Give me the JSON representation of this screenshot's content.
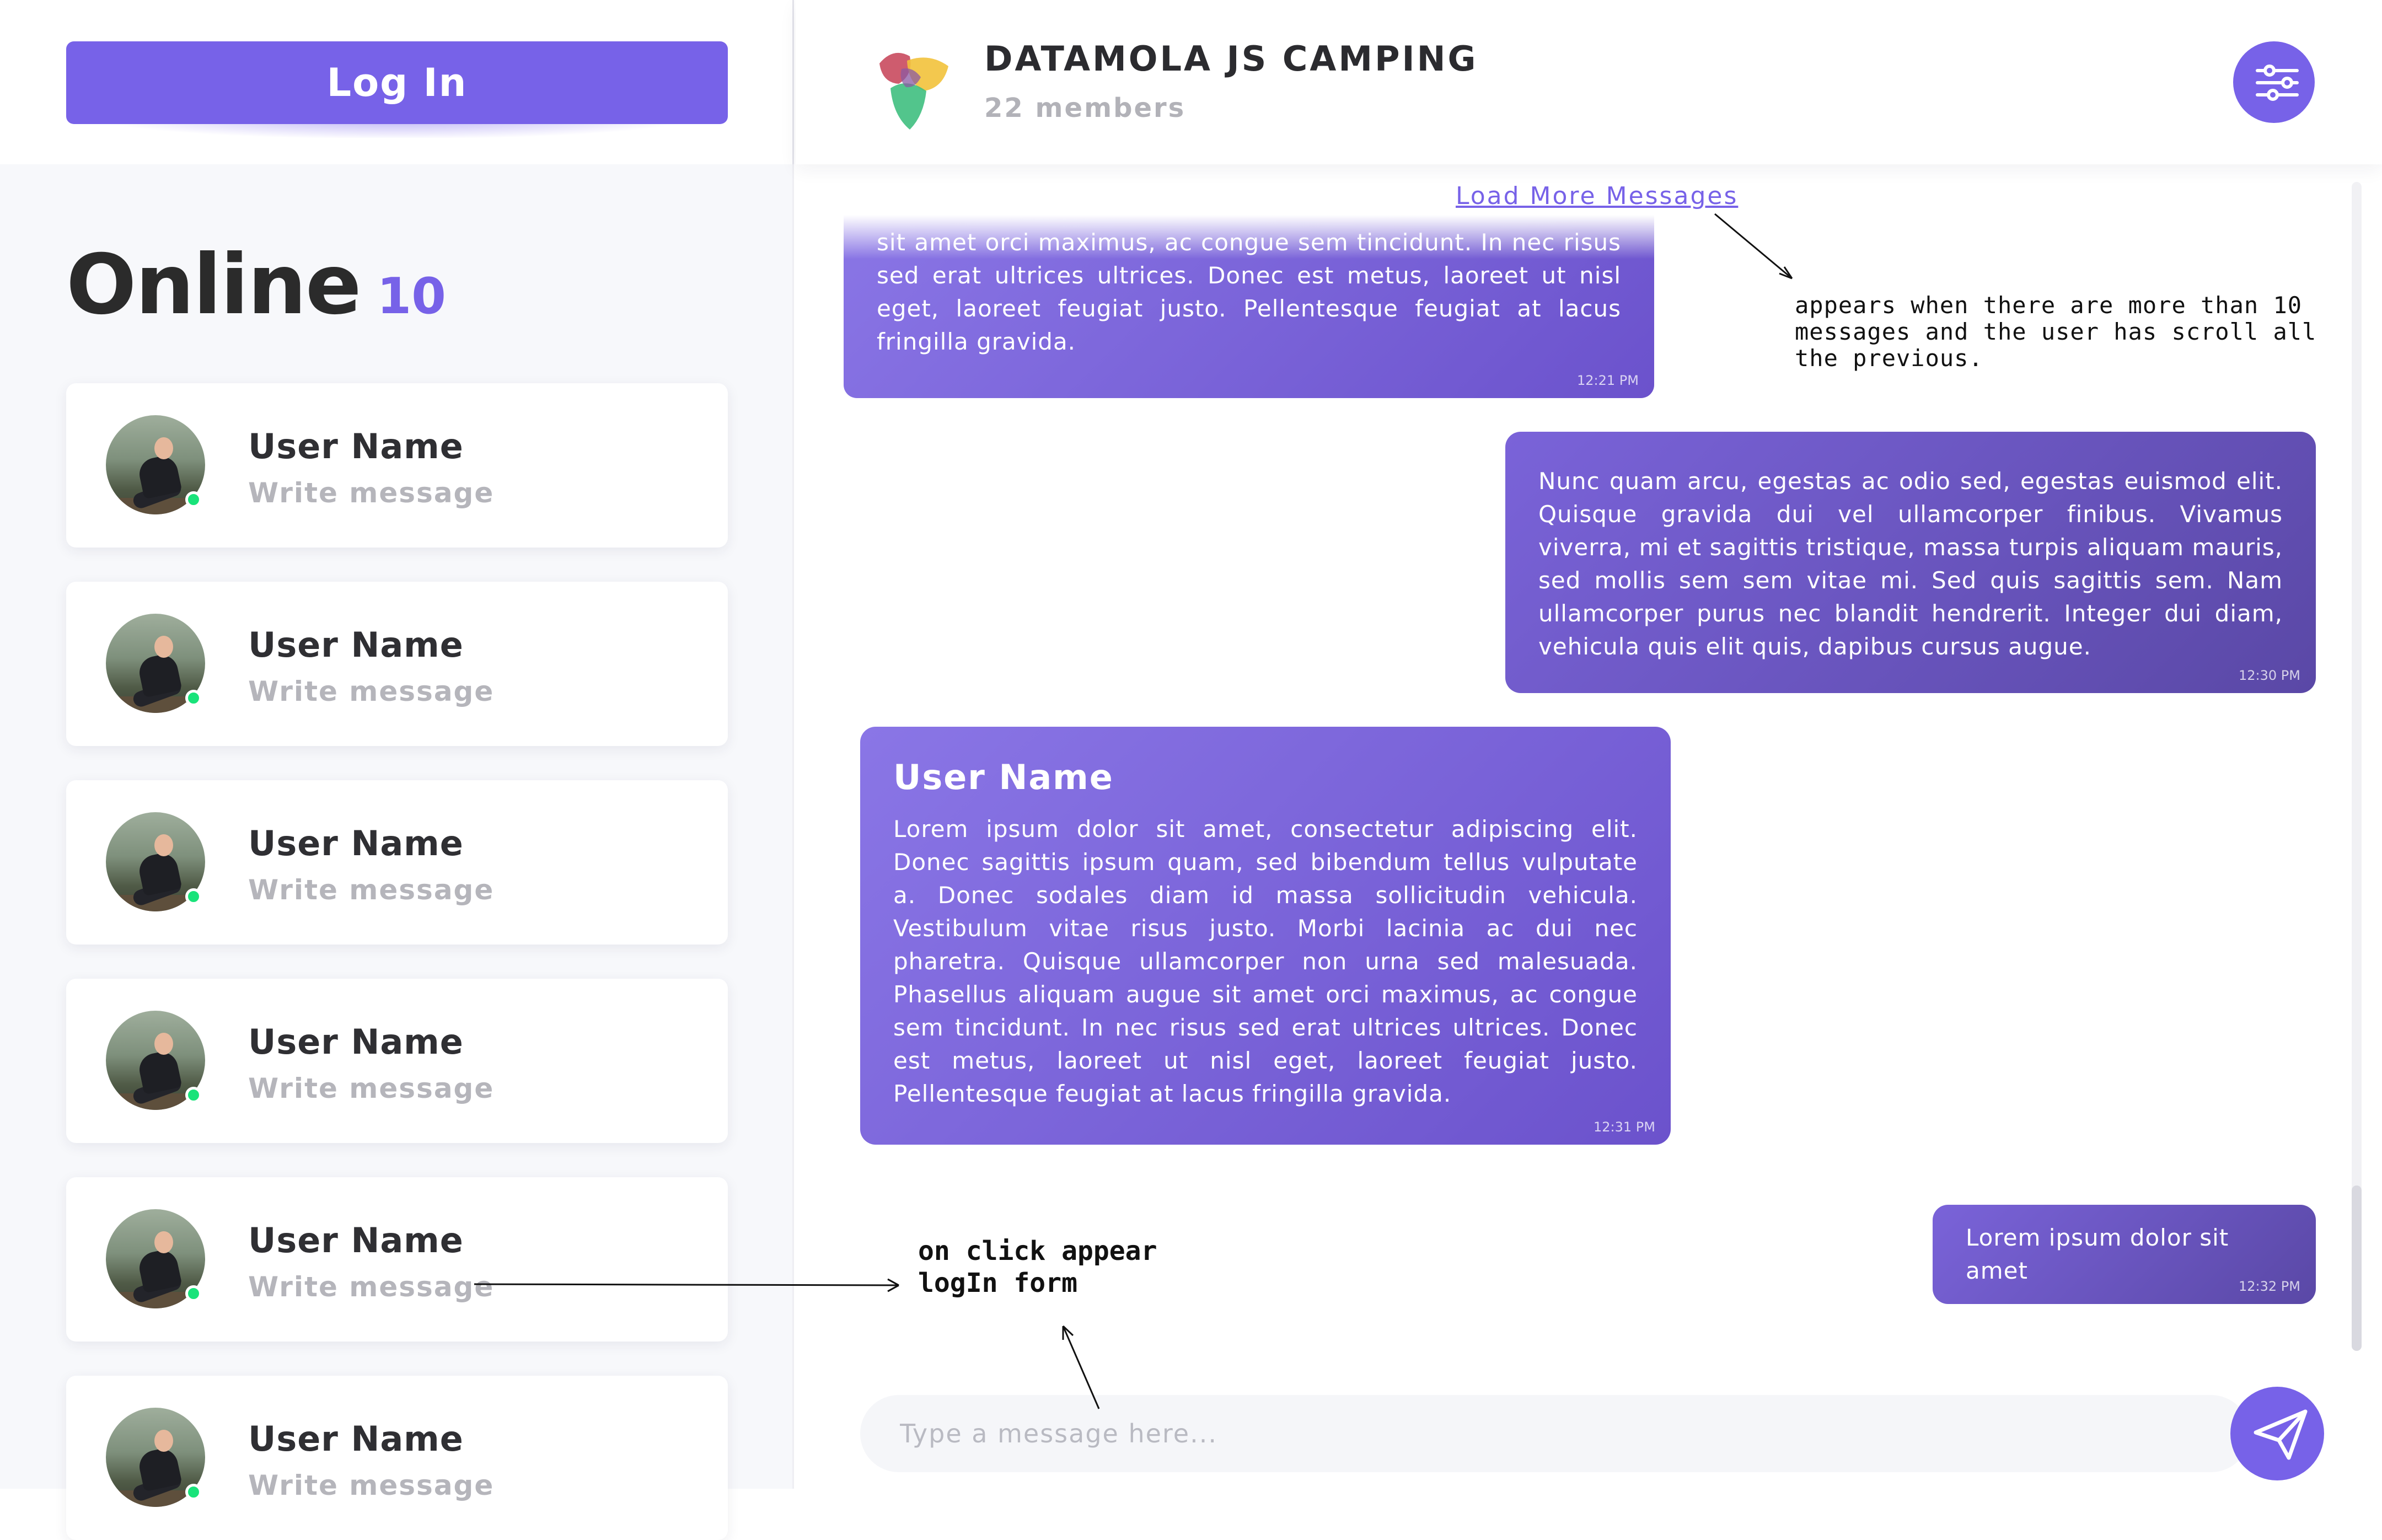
{
  "left_panel": {
    "login_label": "Log In",
    "online_label": "Online",
    "online_count": "10"
  },
  "users": [
    {
      "name": "User Name",
      "message": "Write message",
      "online": true
    },
    {
      "name": "User Name",
      "message": "Write message",
      "online": true
    },
    {
      "name": "User Name",
      "message": "Write message",
      "online": true
    },
    {
      "name": "User Name",
      "message": "Write message",
      "online": true
    },
    {
      "name": "User Name",
      "message": "Write message",
      "online": true
    },
    {
      "name": "User Name",
      "message": "Write message",
      "online": true
    }
  ],
  "chat_header": {
    "title": "DATAMOLA JS CAMPING",
    "members": "22 members",
    "settings_icon": "sliders-icon"
  },
  "chat": {
    "load_more": "Load More Messages",
    "messages": [
      {
        "direction": "incoming",
        "sender": "",
        "text": "sit amet orci maximus, ac congue sem tincidunt. In nec risus sed erat ultrices ultrices. Donec est metus, laoreet ut nisl eget, laoreet feugiat justo. Pellentesque feugiat at lacus fringilla gravida.",
        "time": "12:21 PM"
      },
      {
        "direction": "outgoing",
        "sender": "",
        "text": "Nunc quam arcu, egestas ac odio sed, egestas euismod elit. Quisque gravida dui vel ullamcorper finibus. Vivamus viverra, mi et sagittis tristique, massa turpis aliquam mauris, sed mollis sem sem vitae mi. Sed quis sagittis sem. Nam ullamcorper purus nec blandit hendrerit. Integer dui diam, vehicula quis elit quis, dapibus cursus augue.",
        "time": "12:30 PM"
      },
      {
        "direction": "incoming",
        "sender": "User Name",
        "text": "Lorem ipsum dolor sit amet, consectetur adipiscing elit. Donec sagittis ipsum quam, sed bibendum tellus vulputate a. Donec sodales diam id massa sollicitudin vehicula. Vestibulum vitae risus justo. Morbi lacinia ac dui nec pharetra. Quisque ullamcorper non urna sed malesuada. Phasellus aliquam augue sit amet orci maximus, ac congue sem tincidunt. In nec risus sed erat ultrices ultrices. Donec est metus, laoreet ut nisl eget, laoreet feugiat justo. Pellentesque feugiat at lacus fringilla gravida.",
        "time": "12:31 PM"
      },
      {
        "direction": "outgoing",
        "sender": "",
        "text": "Lorem ipsum dolor sit amet",
        "time": "12:32 PM"
      }
    ]
  },
  "annotations": {
    "load_more_note": "appears when there are more than 10 messages and the user has scroll all the previous.",
    "login_note_line1": "on click appear",
    "login_note_line2": "logIn form"
  },
  "composer": {
    "placeholder": "Type a message here...",
    "value": "",
    "send_icon": "paper-plane-icon"
  },
  "colors": {
    "accent": "#7762e8",
    "online_dot": "#19e37a"
  }
}
